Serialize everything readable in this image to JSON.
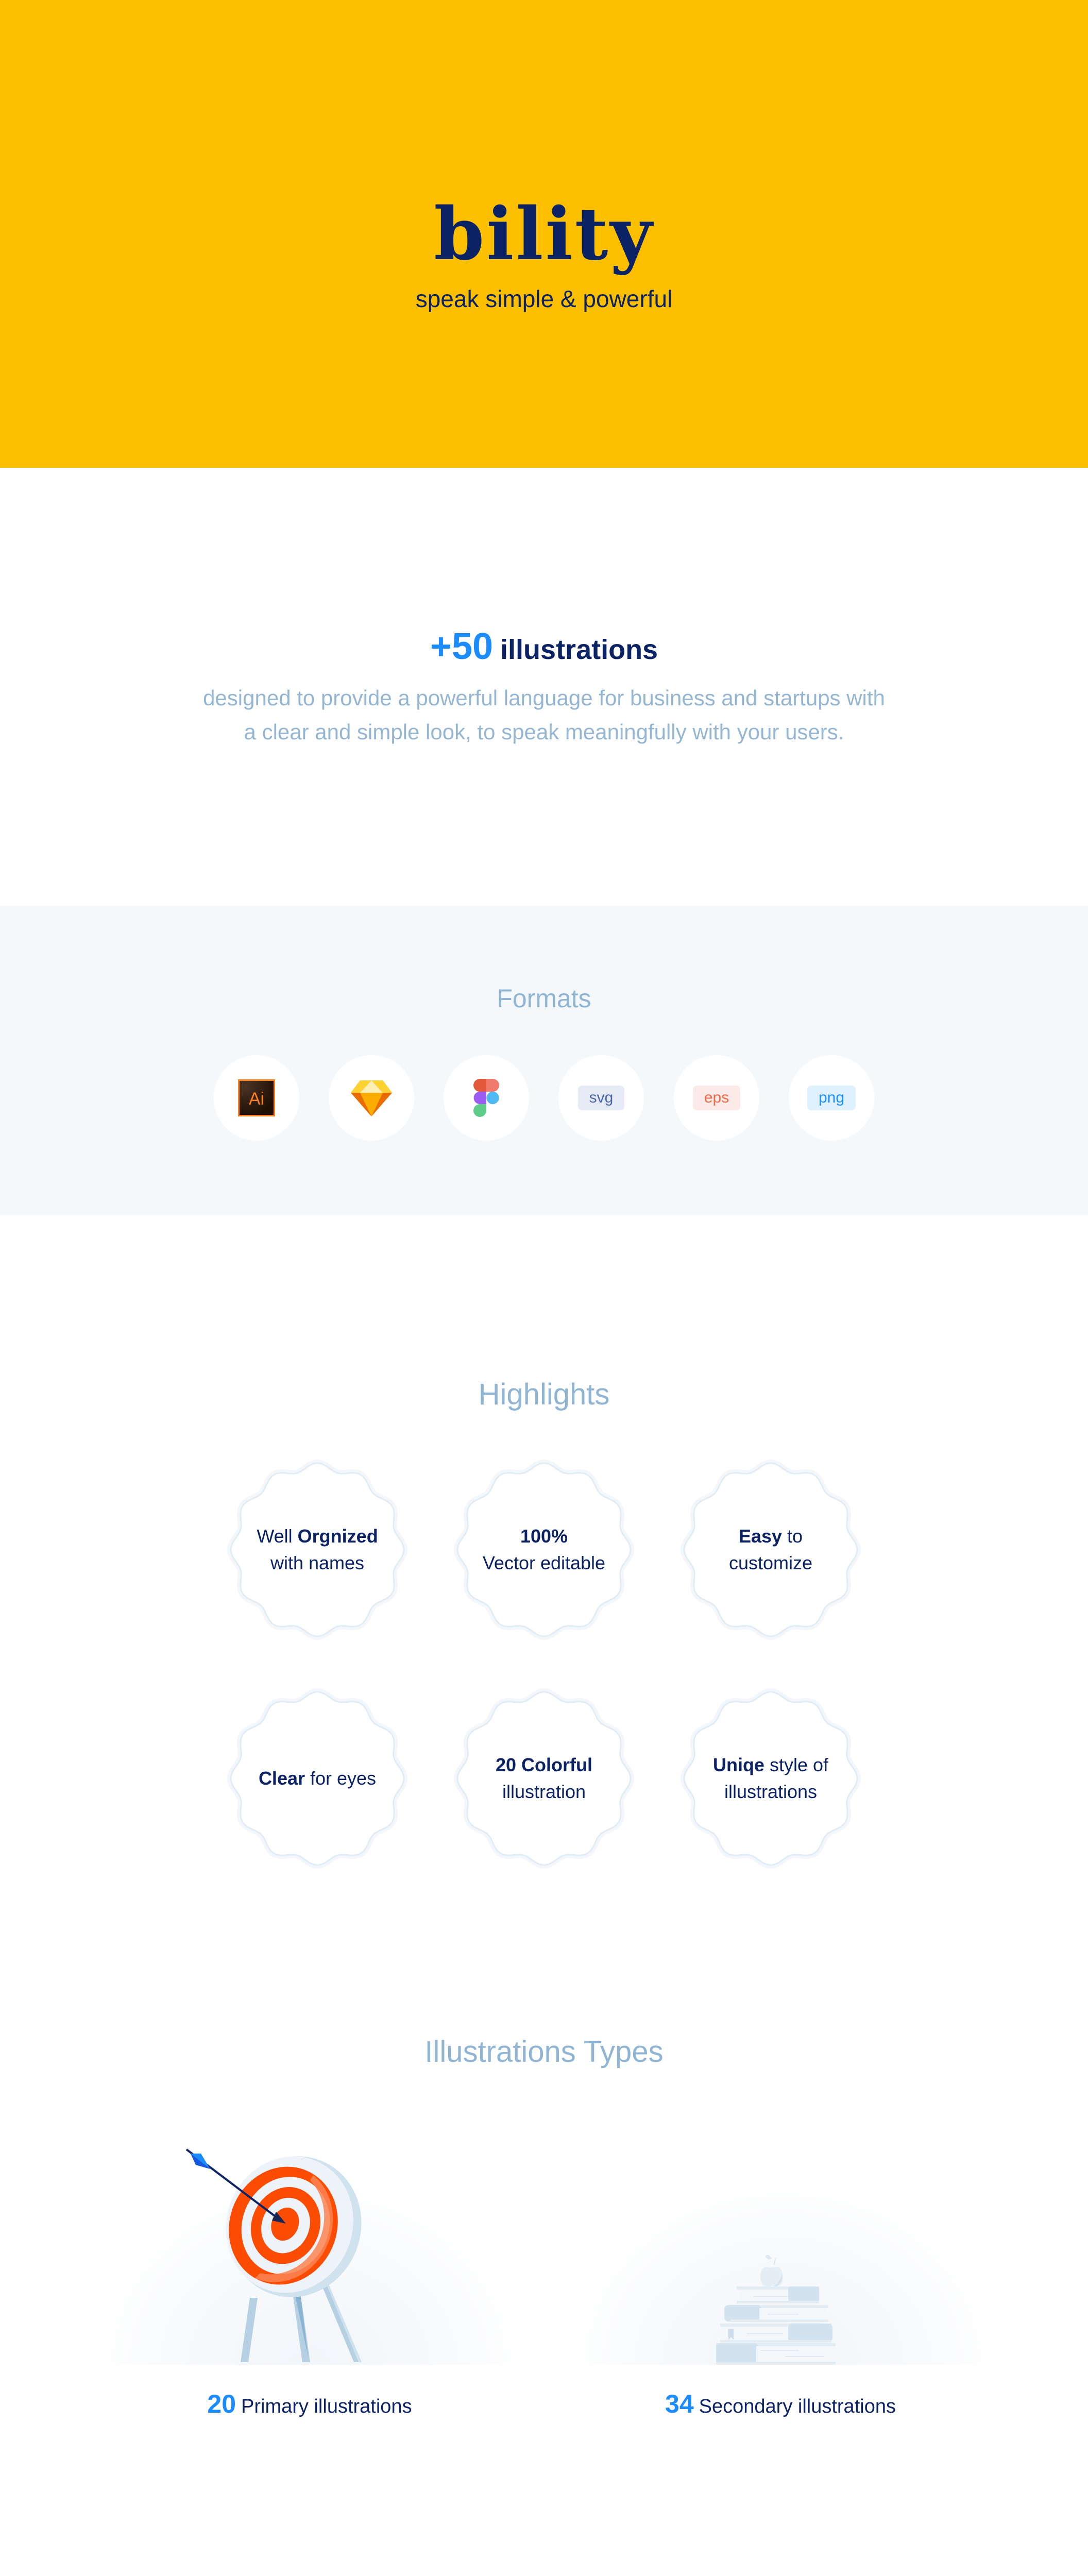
{
  "hero": {
    "brand": "bility",
    "tagline": "speak simple & powerful",
    "background_color": "#FCC000"
  },
  "intro": {
    "count": "+50",
    "word": "illustrations",
    "description_line1": "designed to provide a powerful language for business and startups with",
    "description_line2": "a clear and simple look, to speak meaningfully with your users."
  },
  "formats": {
    "title": "Formats",
    "items": [
      {
        "name": "Adobe Illustrator",
        "icon": "illustrator-icon",
        "label": "Ai"
      },
      {
        "name": "Sketch",
        "icon": "sketch-icon",
        "label": ""
      },
      {
        "name": "Figma",
        "icon": "figma-icon",
        "label": ""
      },
      {
        "name": "svg",
        "icon": "svg-tag",
        "label": "svg",
        "color": "#4C65B0"
      },
      {
        "name": "eps",
        "icon": "eps-tag",
        "label": "eps",
        "color": "#F06A4A"
      },
      {
        "name": "png",
        "icon": "png-tag",
        "label": "png",
        "color": "#1A8CFF"
      }
    ]
  },
  "highlights": {
    "title": "Highlights",
    "items": [
      {
        "pre": "Well ",
        "bold": "Orgnized",
        "post": "",
        "line2": "with names"
      },
      {
        "pre": "",
        "bold": "100%",
        "post": "",
        "line2": "Vector editable"
      },
      {
        "pre": "",
        "bold": "Easy",
        "post": " to",
        "line2": "customize"
      },
      {
        "pre": "",
        "bold": "Clear",
        "post": " for eyes",
        "line2": ""
      },
      {
        "pre": "",
        "bold": "20 Colorful",
        "post": "",
        "line2": "illustration"
      },
      {
        "pre": "",
        "bold": "Uniqe",
        "post": " style of",
        "line2": "illustrations"
      }
    ]
  },
  "types": {
    "title": "Illustrations Types",
    "items": [
      {
        "count": "20",
        "label": "Primary illustrations",
        "illustration": "target-with-arrow"
      },
      {
        "count": "34",
        "label": "Secondary illustrations",
        "illustration": "books-with-apple"
      }
    ]
  },
  "colors": {
    "accent_blue": "#1A8CFF",
    "navy": "#0B2265",
    "muted_blue": "#8FB4D4",
    "band_bg": "#F4F8FB"
  }
}
